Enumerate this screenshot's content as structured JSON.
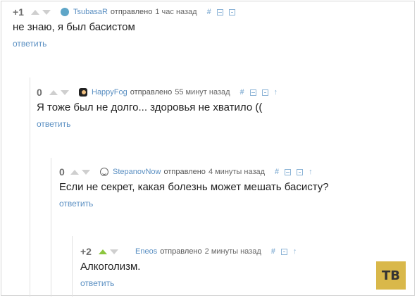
{
  "comments": [
    {
      "rating": "+1",
      "user": "TsubasaR",
      "meta": "отправлено",
      "time": "1 час назад",
      "text": "не знаю, я был басистом",
      "reply": "ответить",
      "upvote_active": false,
      "icons": [
        "hash-icon",
        "collapse-icon",
        "save-icon"
      ]
    },
    {
      "rating": "0",
      "user": "HappyFog",
      "meta": "отправлено",
      "time": "55 минут назад",
      "text": "Я тоже был не долго... здоровья не хватило ((",
      "reply": "ответить",
      "upvote_active": false,
      "icons": [
        "hash-icon",
        "collapse-icon",
        "save-icon",
        "parent-arrow-icon"
      ]
    },
    {
      "rating": "0",
      "user": "StepanovNow",
      "meta": "отправлено",
      "time": "4 минуты назад",
      "text": "Если не секрет, какая болезнь может мешать басисту?",
      "reply": "ответить",
      "upvote_active": false,
      "icons": [
        "hash-icon",
        "collapse-icon",
        "save-icon",
        "parent-arrow-icon"
      ]
    },
    {
      "rating": "+2",
      "user": "Eneos",
      "meta": "отправлено",
      "time": "2 минуты назад",
      "text": "Алкоголизм.",
      "reply": "ответить",
      "upvote_active": true,
      "icons": [
        "hash-icon",
        "save-icon",
        "parent-arrow-icon"
      ]
    }
  ],
  "glyphs": {
    "hash": "#",
    "up": "↑"
  },
  "badge": {
    "text": "TB"
  },
  "colors": {
    "accent": "#5a8fc2",
    "upvote_active": "#8cc63e",
    "badge": "#d9b84a"
  }
}
